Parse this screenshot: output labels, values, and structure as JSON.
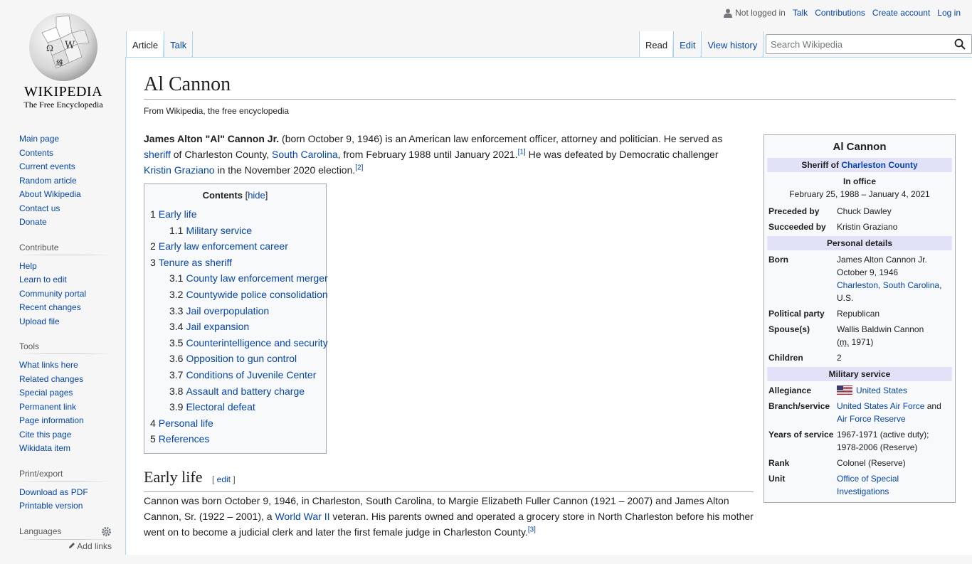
{
  "logo": {
    "wordmark": "WIKIPEDIA",
    "tagline": "The Free Encyclopedia"
  },
  "personal": {
    "status": "Not logged in",
    "links": [
      "Talk",
      "Contributions",
      "Create account",
      "Log in"
    ]
  },
  "tabs": {
    "left": [
      "Article",
      "Talk"
    ],
    "right": [
      "Read",
      "Edit",
      "View history"
    ]
  },
  "search": {
    "placeholder": "Search Wikipedia"
  },
  "sidebar": {
    "main": [
      "Main page",
      "Contents",
      "Current events",
      "Random article",
      "About Wikipedia",
      "Contact us",
      "Donate"
    ],
    "contribute": {
      "heading": "Contribute",
      "items": [
        "Help",
        "Learn to edit",
        "Community portal",
        "Recent changes",
        "Upload file"
      ]
    },
    "tools": {
      "heading": "Tools",
      "items": [
        "What links here",
        "Related changes",
        "Special pages",
        "Permanent link",
        "Page information",
        "Cite this page",
        "Wikidata item"
      ]
    },
    "print": {
      "heading": "Print/export",
      "items": [
        "Download as PDF",
        "Printable version"
      ]
    },
    "languages": {
      "heading": "Languages",
      "add": "Add links"
    }
  },
  "article": {
    "title": "Al Cannon",
    "subtitle": "From Wikipedia, the free encyclopedia",
    "lead": {
      "bold": "James Alton \"Al\" Cannon Jr.",
      "t1": " (born October 9, 1946) is an American law enforcement officer, attorney and politician. He served as ",
      "l1": "sheriff",
      "t2": " of Charleston County, ",
      "l2": "South Carolina",
      "t3": ", from February 1988 until January 2021.",
      "ref1": "[1]",
      "t4": " He was defeated by Democratic challenger ",
      "l3": "Kristin Graziano",
      "t5": " in the November 2020 election.",
      "ref2": "[2]"
    },
    "toc": {
      "title": "Contents",
      "hide": "hide",
      "items": [
        {
          "num": "1",
          "label": "Early life"
        },
        {
          "num": "1.1",
          "label": "Military service",
          "sub": true
        },
        {
          "num": "2",
          "label": "Early law enforcement career"
        },
        {
          "num": "3",
          "label": "Tenure as sheriff"
        },
        {
          "num": "3.1",
          "label": "County law enforcement merger",
          "sub": true
        },
        {
          "num": "3.2",
          "label": "Countywide police consolidation",
          "sub": true
        },
        {
          "num": "3.3",
          "label": "Jail overpopulation",
          "sub": true
        },
        {
          "num": "3.4",
          "label": "Jail expansion",
          "sub": true
        },
        {
          "num": "3.5",
          "label": "Counterintelligence and security",
          "sub": true
        },
        {
          "num": "3.6",
          "label": "Opposition to gun control",
          "sub": true
        },
        {
          "num": "3.7",
          "label": "Conditions of Juvenile Center",
          "sub": true
        },
        {
          "num": "3.8",
          "label": "Assault and battery charge",
          "sub": true
        },
        {
          "num": "3.9",
          "label": "Electoral defeat",
          "sub": true
        },
        {
          "num": "4",
          "label": "Personal life"
        },
        {
          "num": "5",
          "label": "References"
        }
      ]
    },
    "section1": {
      "heading": "Early life",
      "edit": "edit",
      "t1": "Cannon was born October 9, 1946, in Charleston, South Carolina, to Margie Elizabeth Fuller Cannon (1921 – 2007) and James Alton Cannon, Sr. (1922 – 2001), a ",
      "l1": "World War II",
      "t2": " veteran. His parents owned and operated a grocery store in North Charleston before his mother went on to become a judicial clerk and later the first female judge in Charleston County.",
      "ref": "[3]"
    }
  },
  "infobox": {
    "title": "Al Cannon",
    "office_prefix": "Sheriff of ",
    "office_link": "Charleston County",
    "in_office": "In office",
    "term": "February 25, 1988 – January 4, 2021",
    "preceded_label": "Preceded by",
    "preceded": "Chuck Dawley",
    "succeeded_label": "Succeeded by",
    "succeeded": "Kristin Graziano",
    "personal_heading": "Personal details",
    "born_label": "Born",
    "born_name": "James Alton Cannon Jr.",
    "born_date": "October 9, 1946",
    "born_place": "Charleston, South Carolina",
    "born_country": ", U.S.",
    "party_label": "Political party",
    "party": "Republican",
    "spouse_label": "Spouse(s)",
    "spouse": "Wallis Baldwin Cannon",
    "spouse_m": "m.",
    "spouse_open": "(",
    "spouse_year": " 1971)",
    "children_label": "Children",
    "children": "2",
    "military_heading": "Military service",
    "allegiance_label": "Allegiance",
    "allegiance": "United States",
    "branch_label": "Branch/service",
    "branch1": "United States Air Force",
    "branch_and": " and ",
    "branch2": "Air Force Reserve",
    "years_label": "Years of service",
    "years": "1967-1971 (active duty); 1978-2006 (Reserve)",
    "rank_label": "Rank",
    "rank": "Colonel (Reserve)",
    "unit_label": "Unit",
    "unit": "Office of Special Investigations"
  }
}
